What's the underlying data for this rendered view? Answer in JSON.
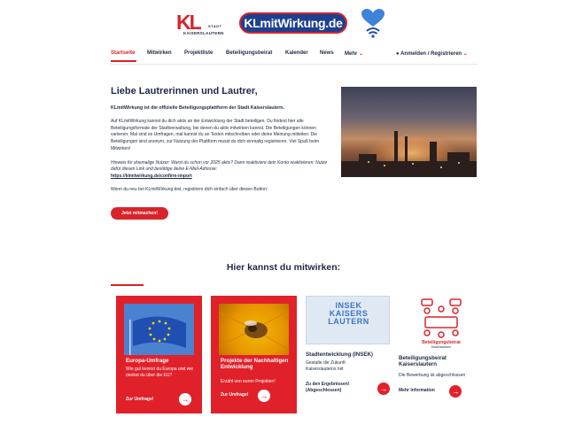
{
  "header": {
    "kl_logo": {
      "mark": "KL",
      "stadt": "STADT",
      "city": "KAISERSLAUTERN"
    },
    "brand": "KLmitWirkung.de"
  },
  "nav": {
    "items": [
      "Startseite",
      "Mitwirken",
      "Projektliste",
      "Beteiligungsbeirat",
      "Kalender",
      "News",
      "Mehr"
    ],
    "login": "Anmelden / Registrieren",
    "active_index": 0
  },
  "intro": {
    "heading": "Liebe Lautrerinnen und Lautrer,",
    "lead": "KLmitWirkung ist die offizielle Beteiligungsplattform der Stadt Kaiserslautern.",
    "body": "Auf KLmitWirkung kannst du dich aktiv an der Entwicklung der Stadt beteiligen. Du findest hier alle Beteiligungsformate der Stadtverwaltung, bei denen du aktiv mitwirken kannst. Die Beteiligungen können variieren: Mal sind es Umfragen, mal kannst du an Texten mitschreiben oder deine Meinung mitteilen. Die Beteiligungen sind anonym, zur Nutzung der Plattform musst du dich einmalig registrieren. Viel Spaß beim Mitwirken!",
    "hint": "Hinweis für ehemalige Nutzer: Warst du schon vor 2025 aktiv? Dann reaktiviere dein Konto reaktivieren: Nutze dafür diesen Link und bestätige deine E-Mail-Adresse:",
    "hint_link": "https://klmitwirkung.de/confirm-import",
    "new_user": "Wenn du neu bei KLmitWirkung bist, registriere dich einfach über diesen Button:",
    "button": "Jetzt mitmachen!"
  },
  "section": {
    "title": "Hier kannst du mitwirken:"
  },
  "cards": [
    {
      "title": "Europa-Umfrage",
      "desc": "Wie gut kennst du Europa und wie denkst du über die EU?",
      "cta": "Zur Umfrage!"
    },
    {
      "title": "Projekte der Nachhaltigen Entwicklung",
      "desc": "Erzähl von euren Projekten!",
      "cta": "Zur Umfrage!"
    },
    {
      "title": "Stadtentwicklung (INSEK)",
      "desc": "Gestalte die Zukunft Kaiserslauterns mit",
      "cta": "Zu den Ergebnissen! (Abgeschlossen)",
      "image_text": "INSEK KAISERS LAUTERN"
    },
    {
      "title": "Beteiligungsbeirat Kaiserslautern",
      "desc": "Die Bewerbung ist abgeschlossen",
      "cta": "Mehr Information",
      "image_text": "Beteiligungsbeirat",
      "image_subtext": "Kaiserslautern"
    }
  ],
  "colors": {
    "accent": "#d8232a",
    "navy": "#1d2a44",
    "brand_blue": "#1f3f8f"
  }
}
